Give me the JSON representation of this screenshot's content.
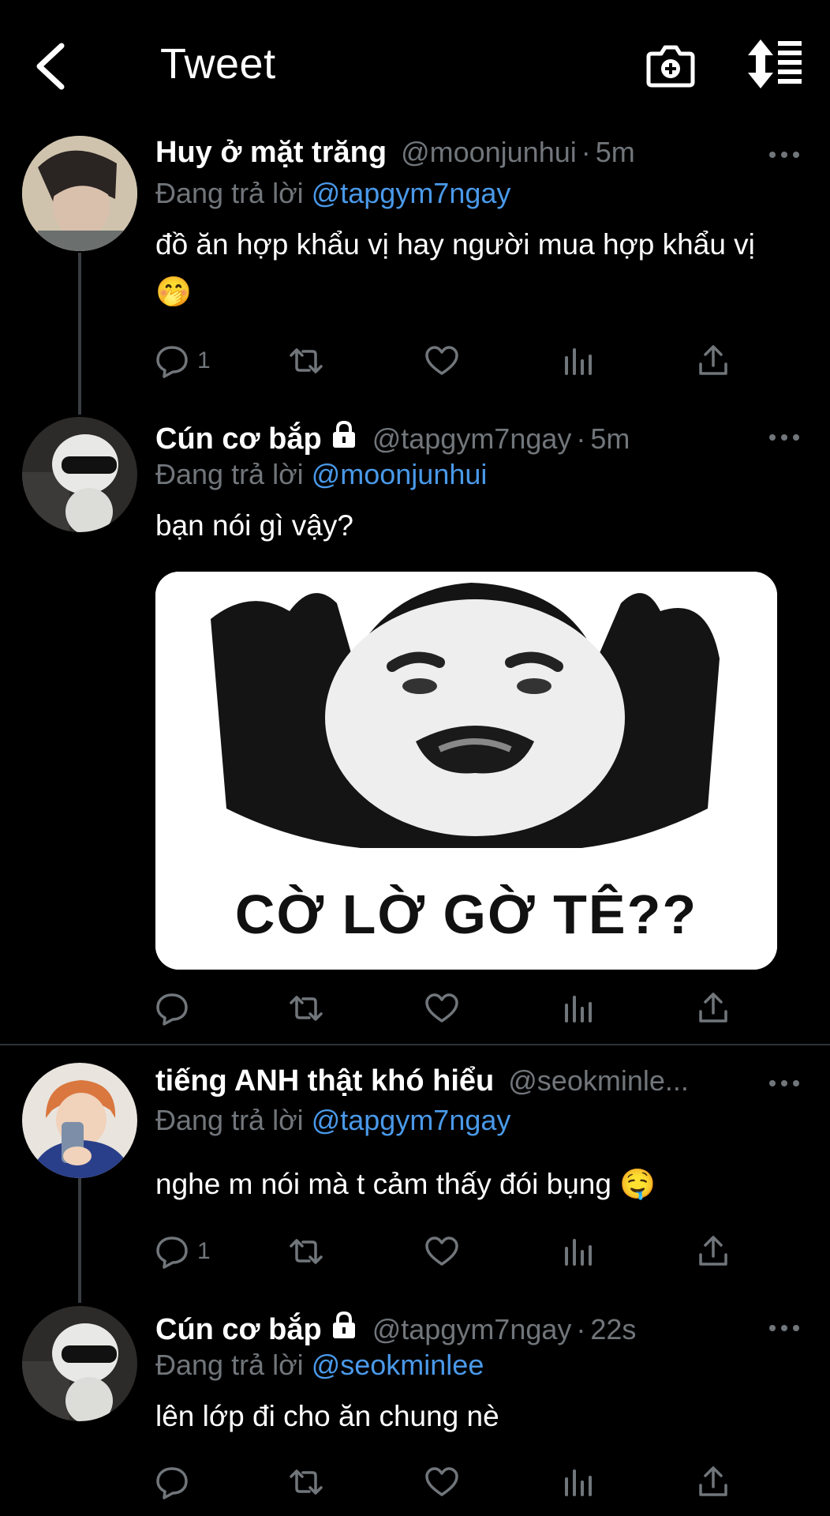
{
  "header": {
    "title": "Tweet"
  },
  "tweets": [
    {
      "name": "Huy ở mặt trăng",
      "handle": "@moonjunhui",
      "dot": "·",
      "time": "5m",
      "replying_prefix": "Đang trả lời",
      "replying_to": "@tapgym7ngay",
      "text": "đồ ăn hợp khẩu vị hay người mua hợp khẩu vị 🤭",
      "reply_count": "1"
    },
    {
      "name": "Cún cơ bắp",
      "handle": "@tapgym7ngay",
      "dot": "·",
      "time": "5m",
      "replying_prefix": "Đang trả lời",
      "replying_to": "@moonjunhui",
      "text": "bạn nói gì vậy?",
      "media_caption": "CỜ LỜ GỜ TÊ??",
      "reply_count": ""
    },
    {
      "name": "tiếng ANH thật khó hiểu",
      "handle": "@seokminle...",
      "dot": "",
      "time": "",
      "replying_prefix": "Đang trả lời",
      "replying_to": "@tapgym7ngay",
      "text": "nghe m nói mà t cảm thấy đói bụng 🤤",
      "reply_count": "1"
    },
    {
      "name": "Cún cơ bắp",
      "handle": "@tapgym7ngay",
      "dot": "·",
      "time": "22s",
      "replying_prefix": "Đang trả lời",
      "replying_to": "@seokminlee",
      "text": "lên lớp đi cho ăn chung nè",
      "reply_count": ""
    }
  ],
  "icons": {
    "back": "chevron-left-icon",
    "camera": "camera-add-icon",
    "sort": "sort-icon",
    "reply": "reply-icon",
    "retweet": "retweet-icon",
    "like": "heart-icon",
    "views": "analytics-icon",
    "share": "share-icon",
    "more": "more-icon",
    "lock": "lock-icon"
  },
  "colors": {
    "background": "#000000",
    "mention": "#4a99e9",
    "secondary": "#71767b"
  }
}
